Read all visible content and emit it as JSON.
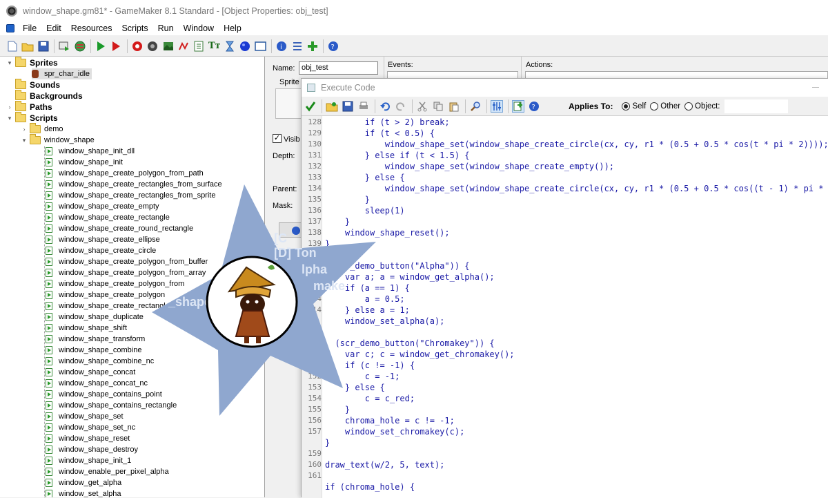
{
  "window": {
    "title": "window_shape.gm81* - GameMaker 8.1 Standard - [Object Properties: obj_test]"
  },
  "menu": [
    "File",
    "Edit",
    "Resources",
    "Scripts",
    "Run",
    "Window",
    "Help"
  ],
  "toolbar_icons": [
    "new-icon",
    "open-icon",
    "save-icon",
    "publish-icon",
    "globe-icon",
    "run-icon",
    "debug-icon",
    "sprite-icon",
    "sound-icon",
    "background-icon",
    "path-icon",
    "script-icon",
    "font-icon",
    "timeline-icon",
    "object-icon",
    "room-icon",
    "game-info-icon",
    "global-settings-icon",
    "extension-icon",
    "help-icon"
  ],
  "tree": {
    "sprites": "Sprites",
    "spr_char_idle": "spr_char_idle",
    "sounds": "Sounds",
    "backgrounds": "Backgrounds",
    "paths": "Paths",
    "scripts": "Scripts",
    "demo": "demo",
    "window_shape": "window_shape",
    "items": [
      "window_shape_init_dll",
      "window_shape_init",
      "window_shape_create_polygon_from_path",
      "window_shape_create_rectangles_from_surface",
      "window_shape_create_rectangles_from_sprite",
      "window_shape_create_empty",
      "window_shape_create_rectangle",
      "window_shape_create_round_rectangle",
      "window_shape_create_ellipse",
      "window_shape_create_circle",
      "window_shape_create_polygon_from_buffer",
      "window_shape_create_polygon_from_array",
      "window_shape_create_polygon_from",
      "window_shape_create_polygon",
      "window_shape_create_rectangles_from",
      "window_shape_duplicate",
      "window_shape_shift",
      "window_shape_transform",
      "window_shape_combine",
      "window_shape_combine_nc",
      "window_shape_concat",
      "window_shape_concat_nc",
      "window_shape_contains_point",
      "window_shape_contains_rectangle",
      "window_shape_set",
      "window_shape_set_nc",
      "window_shape_reset",
      "window_shape_destroy",
      "window_shape_init_1",
      "window_enable_per_pixel_alpha",
      "window_get_alpha",
      "window_set_alpha"
    ]
  },
  "props": {
    "name_label": "Name:",
    "name_value": "obj_test",
    "sprite_label": "Sprite",
    "visible_label": "Visib",
    "depth_label": "Depth:",
    "parent_label": "Parent:",
    "mask_label": "Mask:",
    "events_label": "Events:",
    "actions_label": "Actions:"
  },
  "exec": {
    "title": "Execute Code",
    "applies_to": "Applies To:",
    "self": "Self",
    "other": "Other",
    "object": "Object:",
    "line_numbers": [
      "128",
      "129",
      "130",
      "131",
      "132",
      "133",
      "134",
      "135",
      "136",
      "137",
      "138",
      "139",
      "",
      "",
      "141",
      "142",
      "14",
      "14",
      "",
      "",
      "149",
      "150",
      "151",
      "152",
      "153",
      "154",
      "155",
      "156",
      "157",
      "",
      "159",
      "160",
      "161"
    ],
    "lines": [
      "        if (t > 2) break;",
      "        if (t < 0.5) {",
      "            window_shape_set(window_shape_create_circle(cx, cy, r1 * (0.5 + 0.5 * cos(t * pi * 2))));",
      "        } else if (t < 1.5) {",
      "            window_shape_set(window_shape_create_empty());",
      "        } else {",
      "            window_shape_set(window_shape_create_circle(cx, cy, r1 * (0.5 + 0.5 * cos((t - 1) * pi * 2))",
      "        }",
      "        sleep(1)",
      "    }",
      "    window_shape_reset();",
      "}",
      "",
      "  scr_demo_button(\"Alpha\")) {",
      "    var a; a = window_get_alpha();",
      "    if (a == 1) {",
      "        a = 0.5;",
      "    } else a = 1;",
      "    window_set_alpha(a);",
      "",
      "  (scr_demo_button(\"Chromakey\")) {",
      "    var c; c = window_get_chromakey();",
      "    if (c != -1) {",
      "        c = -1;",
      "    } else {",
      "        c = c_red;",
      "    }",
      "    chroma_hole = c != -1;",
      "    window_set_chromakey(c);",
      "}",
      "",
      "draw_text(w/2, 5, text);",
      "",
      "if (chroma_hole) {"
    ]
  },
  "star_text": [
    "[C",
    "[D] Ton",
    "lpha",
    "make",
    "_shape"
  ]
}
